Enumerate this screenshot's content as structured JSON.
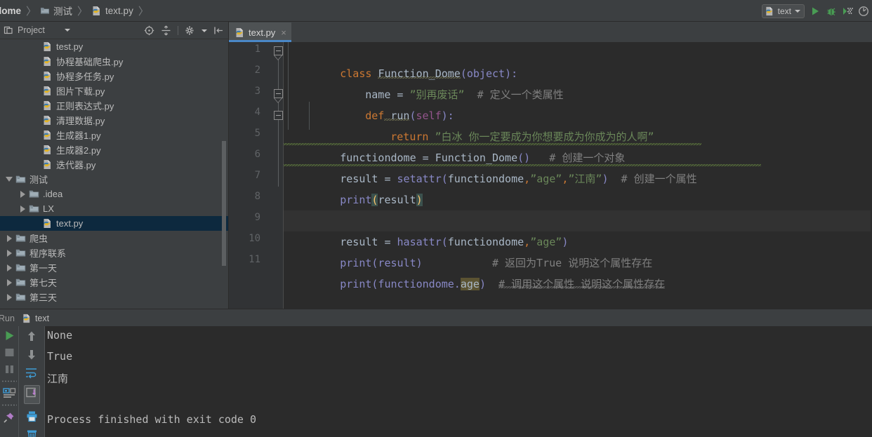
{
  "window": {
    "theme_bg": "#3c3f41",
    "editor_bg": "#2b2b2b",
    "accent": "#4a88c7",
    "selection_blue": "#0d293e"
  },
  "breadcrumb": {
    "items": [
      {
        "label": "dome",
        "icon": ""
      },
      {
        "label": "测试",
        "icon": "folder-icon"
      },
      {
        "label": "text.py",
        "icon": "python-file-icon"
      }
    ],
    "separator": "〉"
  },
  "toolbar": {
    "run_configuration": "text",
    "run_button": "run-icon",
    "debug_button": "debug-icon",
    "coverage_button": "coverage-icon",
    "profile_button": "profile-icon"
  },
  "project_panel": {
    "title": "Project",
    "tools": [
      "target-icon",
      "collapse-all-icon",
      "settings-icon",
      "hide-icon"
    ],
    "tree": [
      {
        "label": "test.py",
        "icon": "python-file-icon",
        "indent": 3,
        "arrow": "none",
        "selected": false
      },
      {
        "label": "协程基础爬虫.py",
        "icon": "python-file-icon",
        "indent": 3,
        "arrow": "none",
        "selected": false
      },
      {
        "label": "协程多任务.py",
        "icon": "python-file-icon",
        "indent": 3,
        "arrow": "none",
        "selected": false
      },
      {
        "label": "图片下载.py",
        "icon": "python-file-icon",
        "indent": 3,
        "arrow": "none",
        "selected": false
      },
      {
        "label": "正则表达式.py",
        "icon": "python-file-icon",
        "indent": 3,
        "arrow": "none",
        "selected": false
      },
      {
        "label": "清理数据.py",
        "icon": "python-file-icon",
        "indent": 3,
        "arrow": "none",
        "selected": false
      },
      {
        "label": "生成器1.py",
        "icon": "python-file-icon",
        "indent": 3,
        "arrow": "none",
        "selected": false
      },
      {
        "label": "生成器2.py",
        "icon": "python-file-icon",
        "indent": 3,
        "arrow": "none",
        "selected": false
      },
      {
        "label": "迭代器.py",
        "icon": "python-file-icon",
        "indent": 3,
        "arrow": "none",
        "selected": false
      },
      {
        "label": "测试",
        "icon": "folder-open-icon",
        "indent": 1,
        "arrow": "expanded",
        "selected": false
      },
      {
        "label": ".idea",
        "icon": "folder-plain-icon",
        "indent": 2,
        "arrow": "collapsed",
        "selected": false
      },
      {
        "label": "LX",
        "icon": "folder-open-icon",
        "indent": 2,
        "arrow": "collapsed",
        "selected": false
      },
      {
        "label": "text.py",
        "icon": "python-file-icon",
        "indent": 3,
        "arrow": "none",
        "selected": true
      },
      {
        "label": "爬虫",
        "icon": "folder-open-icon",
        "indent": 1,
        "arrow": "collapsed",
        "selected": false
      },
      {
        "label": "程序联系",
        "icon": "folder-open-icon",
        "indent": 1,
        "arrow": "collapsed",
        "selected": false
      },
      {
        "label": "第一天",
        "icon": "folder-open-icon",
        "indent": 1,
        "arrow": "collapsed",
        "selected": false
      },
      {
        "label": "第七天",
        "icon": "folder-open-icon",
        "indent": 1,
        "arrow": "collapsed",
        "selected": false
      },
      {
        "label": "第三天",
        "icon": "folder-open-icon",
        "indent": 1,
        "arrow": "collapsed",
        "selected": false
      }
    ]
  },
  "editor": {
    "tab": {
      "label": "text.py",
      "icon": "python-file-icon",
      "close": "×",
      "active": true
    },
    "line_numbers": [
      "1",
      "2",
      "3",
      "4",
      "5",
      "6",
      "7",
      "8",
      "9",
      "10",
      "11"
    ],
    "caret_line": 7,
    "lines": {
      "l1_kw": "class",
      "l1_name": "Function_Dome",
      "l1_open": "(",
      "l1_base": "object",
      "l1_close": "):",
      "l2_name": "name",
      "l2_eq": " = ",
      "l2_str": "”别再废话”",
      "l2_cmt": "# 定义一个类属性",
      "l3_kw": "def",
      "l3_fn": " run",
      "l3_open": "(",
      "l3_self": "self",
      "l3_close": "):",
      "l4_kw": "return",
      "l4_str": " ”白冰 你一定要成为你想要成为你成为的人啊”",
      "l5_var": "functiondome",
      "l5_eq": " = ",
      "l5_call": "Function_Dome",
      "l5_parens": "()",
      "l5_cmt": "# 创建一个对象",
      "l6_var": "result",
      "l6_eq": " = ",
      "l6_fn": "setattr",
      "l6_open": "(",
      "l6_arg1": "functiondome",
      "l6_comma1": ",",
      "l6_arg2": "”age”",
      "l6_comma2": ",",
      "l6_arg3": "”江南”",
      "l6_close": ")",
      "l6_cmt": "# 创建一个属性",
      "l7_fn": "print",
      "l7_open": "(",
      "l7_arg": "result",
      "l7_close": ")",
      "l9_var": "result",
      "l9_eq": " = ",
      "l9_fn": "hasattr",
      "l9_open": "(",
      "l9_arg1": "functiondome",
      "l9_comma": ",",
      "l9_arg2": "”age”",
      "l9_close": ")",
      "l10_fn": "print",
      "l10_call": "(result)",
      "l10_cmt": "# 返回为True 说明这个属性存在",
      "l11_fn": "print",
      "l11_open": "(functiondome.",
      "l11_attr": "age",
      "l11_close": ")",
      "l11_cmt": "# 调用这个属性 说明这个属性存在"
    }
  },
  "run_panel": {
    "title": "Run",
    "tab_label": "text",
    "tab_icon": "python-file-icon",
    "left_buttons": [
      "rerun-icon",
      "stop-icon",
      "pause-icon",
      "dots-sep",
      "console-icon",
      "dots-sep2",
      "pin-icon"
    ],
    "side_buttons": [
      "up-arrow-icon",
      "down-arrow-icon",
      "soft-wrap-icon",
      "scroll-to-end-icon",
      "print-icon",
      "trash-icon"
    ],
    "output": [
      "None",
      "True",
      "江南",
      "",
      "Process finished with exit code 0"
    ]
  }
}
